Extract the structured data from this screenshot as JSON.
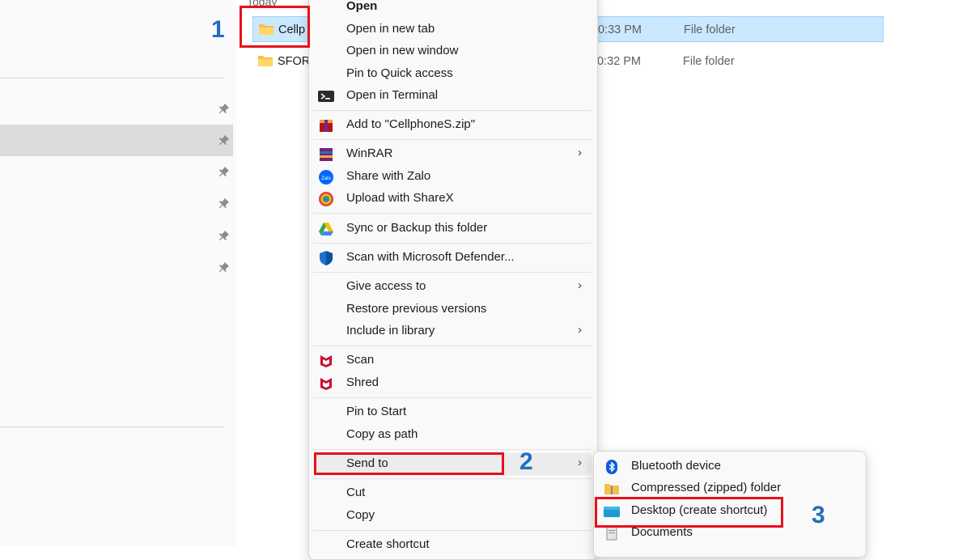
{
  "explorer": {
    "group_header": "Today",
    "files": [
      {
        "name": "Cellp",
        "date": "0:33 PM",
        "type": "File folder"
      },
      {
        "name": "SFOR",
        "date": "0:32 PM",
        "type": "File folder"
      }
    ]
  },
  "context_menu": {
    "open": "Open",
    "open_new_tab": "Open in new tab",
    "open_new_window": "Open in new window",
    "pin_quick_access": "Pin to Quick access",
    "open_terminal": "Open in Terminal",
    "add_to_zip": "Add to \"CellphoneS.zip\"",
    "winrar": "WinRAR",
    "share_zalo": "Share with Zalo",
    "upload_sharex": "Upload with ShareX",
    "sync_backup": "Sync or Backup this folder",
    "scan_defender": "Scan with Microsoft Defender...",
    "give_access": "Give access to",
    "restore_versions": "Restore previous versions",
    "include_library": "Include in library",
    "scan": "Scan",
    "shred": "Shred",
    "pin_start": "Pin to Start",
    "copy_path": "Copy as path",
    "send_to": "Send to",
    "cut": "Cut",
    "copy": "Copy",
    "create_shortcut": "Create shortcut"
  },
  "send_to_menu": {
    "bluetooth": "Bluetooth device",
    "compressed": "Compressed (zipped) folder",
    "desktop": "Desktop (create shortcut)",
    "documents": "Documents"
  },
  "annotations": {
    "step1": "1",
    "step2": "2",
    "step3": "3"
  },
  "colors": {
    "highlight": "#e8101a",
    "step_number": "#1f6fbf",
    "selection": "#cce8ff"
  }
}
